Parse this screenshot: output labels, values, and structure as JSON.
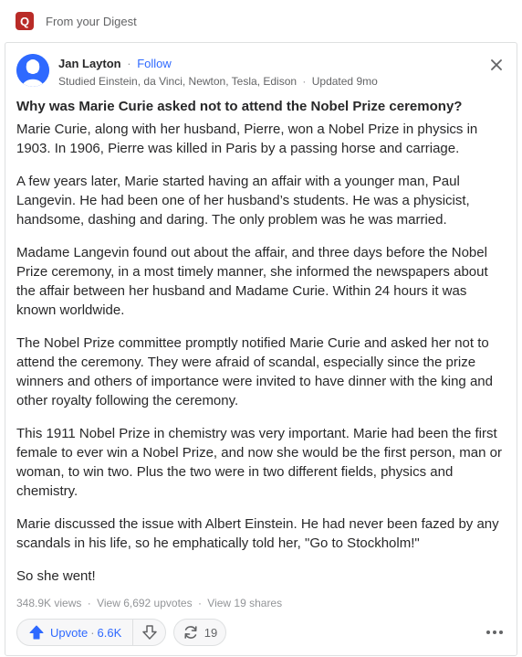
{
  "header": {
    "logo_letter": "Q",
    "digest_label": "From your Digest"
  },
  "author": {
    "name": "Jan Layton",
    "separator": "·",
    "follow_label": "Follow",
    "credential": "Studied Einstein, da Vinci, Newton, Tesla, Edison",
    "updated": "Updated 9mo"
  },
  "question": "Why was Marie Curie asked not to attend the Nobel Prize ceremony?",
  "answer": {
    "paragraphs": [
      "Marie Curie, along with her husband, Pierre, won a Nobel Prize in physics in 1903. In 1906, Pierre was killed in Paris by a passing horse and carriage.",
      "A few years later, Marie started having an affair with a younger man, Paul Langevin. He had been one of her husband’s students. He was a physicist, handsome, dashing and daring. The only problem was he was married.",
      "Madame Langevin found out about the affair, and three days before the Nobel Prize ceremony, in a most timely manner, she informed the newspapers about the affair between her husband and Madame Curie. Within 24 hours it was known worldwide.",
      "The Nobel Prize committee promptly notified Marie Curie and asked her not to attend the ceremony. They were afraid of scandal, especially since the prize winners and others of importance were invited to have dinner with the king and other royalty following the ceremony.",
      "This 1911 Nobel Prize in chemistry was very important. Marie had been the first female to ever win a Nobel Prize, and now she would be the first person, man or woman, to win two. Plus the two were in two different fields, physics and chemistry.",
      "Marie discussed the issue with Albert Einstein. He had never been fazed by any scandals in his life, so he emphatically told her, \"Go to Stockholm!\"",
      "So she went!"
    ]
  },
  "stats": {
    "views": "348.9K views",
    "upvotes": "View 6,692 upvotes",
    "shares": "View 19 shares",
    "separator": "·"
  },
  "actions": {
    "upvote_label": "Upvote",
    "upvote_count": "6.6K",
    "share_count": "19",
    "upvote_separator": "·"
  },
  "colors": {
    "brand": "#b92b27",
    "accent": "#2e69ff",
    "text": "#282829",
    "muted": "#636466"
  },
  "icons": {
    "logo": "quora-logo-icon",
    "avatar": "user-silhouette-icon",
    "close": "close-icon",
    "upvote": "arrow-up-icon",
    "downvote": "arrow-down-icon",
    "share": "share-rotate-icon",
    "more": "more-dots-icon"
  }
}
